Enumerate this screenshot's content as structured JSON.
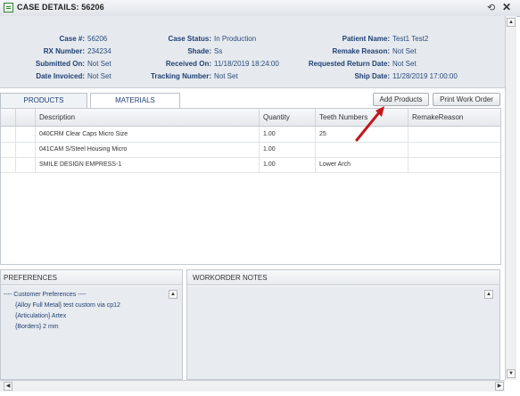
{
  "window": {
    "title": "CASE DETAILS: 56206"
  },
  "case_info": {
    "col1": [
      {
        "label": "Case #:",
        "value": "56206"
      },
      {
        "label": "RX Number:",
        "value": "234234"
      },
      {
        "label": "Submitted On:",
        "value": "Not Set"
      },
      {
        "label": "Date Invoiced:",
        "value": "Not Set"
      }
    ],
    "col2": [
      {
        "label": "Case Status:",
        "value": "In Production"
      },
      {
        "label": "Shade:",
        "value": "Ss"
      },
      {
        "label": "Received On:",
        "value": "11/18/2019 18:24:00"
      },
      {
        "label": "Tracking Number:",
        "value": "Not Set"
      }
    ],
    "col3": [
      {
        "label": "Patient Name:",
        "value": "Test1 Test2"
      },
      {
        "label": "Remake Reason:",
        "value": "Not Set"
      },
      {
        "label": "Requested Return Date:",
        "value": "Not Set"
      },
      {
        "label": "Ship Date:",
        "value": "11/28/2019 17:00:00"
      }
    ]
  },
  "tabs": [
    {
      "label": "PRODUCTS",
      "active": false
    },
    {
      "label": "MATERIALS",
      "active": true
    }
  ],
  "toolbar": {
    "add_products": "Add Products",
    "print_work_order": "Print Work Order"
  },
  "table": {
    "columns": [
      "",
      "",
      "Description",
      "Quantity",
      "Teeth Numbers",
      "RemakeReason"
    ],
    "rows": [
      {
        "description": "040CRM Clear Caps Micro Size",
        "quantity": "1.00",
        "teeth": "25",
        "remake": ""
      },
      {
        "description": "041CAM S/Steel Housing Micro",
        "quantity": "1.00",
        "teeth": "",
        "remake": ""
      },
      {
        "description": "SMILE DESIGN EMPRESS-1",
        "quantity": "1.00",
        "teeth": "Lower Arch",
        "remake": ""
      }
    ]
  },
  "preferences": {
    "title": "PREFERENCES",
    "lines": [
      "---- Customer Preferences ----",
      "{Alloy Full Metal} test custom via cp12",
      "{Articulation} Artex",
      "{Borders} 2 mm"
    ]
  },
  "workorder_notes": {
    "title": "WORKORDER NOTES"
  },
  "colors": {
    "accent": "#c3161c",
    "label": "#1f3f73",
    "panel_bg": "#e6eaef"
  }
}
